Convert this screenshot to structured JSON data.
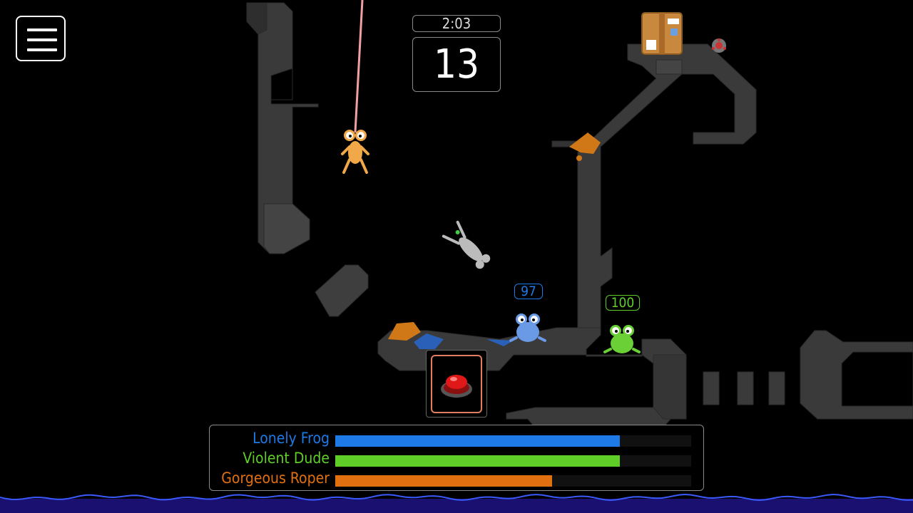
{
  "hud": {
    "menu_icon": "hamburger-icon",
    "timer": "2:03",
    "turn_seconds": "13"
  },
  "fire_button": {
    "icon": "red-push-button-icon"
  },
  "frogs": [
    {
      "team": "Lonely Frog",
      "health_label": "97",
      "color": "#1e7ae6"
    },
    {
      "team": "Violent Dude",
      "health_label": "100",
      "color": "#5fcf28"
    },
    {
      "team": "Gorgeous Roper",
      "color": "#f0a040",
      "state": "swinging-on-rope"
    }
  ],
  "teams": [
    {
      "name": "Lonely Frog",
      "color": "#1e7ae6",
      "health_fraction": 0.8
    },
    {
      "name": "Violent Dude",
      "color": "#5fcf28",
      "health_fraction": 0.8
    },
    {
      "name": "Gorgeous Roper",
      "color": "#e07010",
      "health_fraction": 0.61
    }
  ],
  "pickups": {
    "crate_icon": "cardboard-box-icon",
    "mine_icon": "mine-icon"
  },
  "colors": {
    "terrain": "#3a3a3a",
    "terrain_edge": "#4a4a4a",
    "water": "#1a1070",
    "wave": "#3a5aff",
    "rope": "#f0a0a0"
  }
}
